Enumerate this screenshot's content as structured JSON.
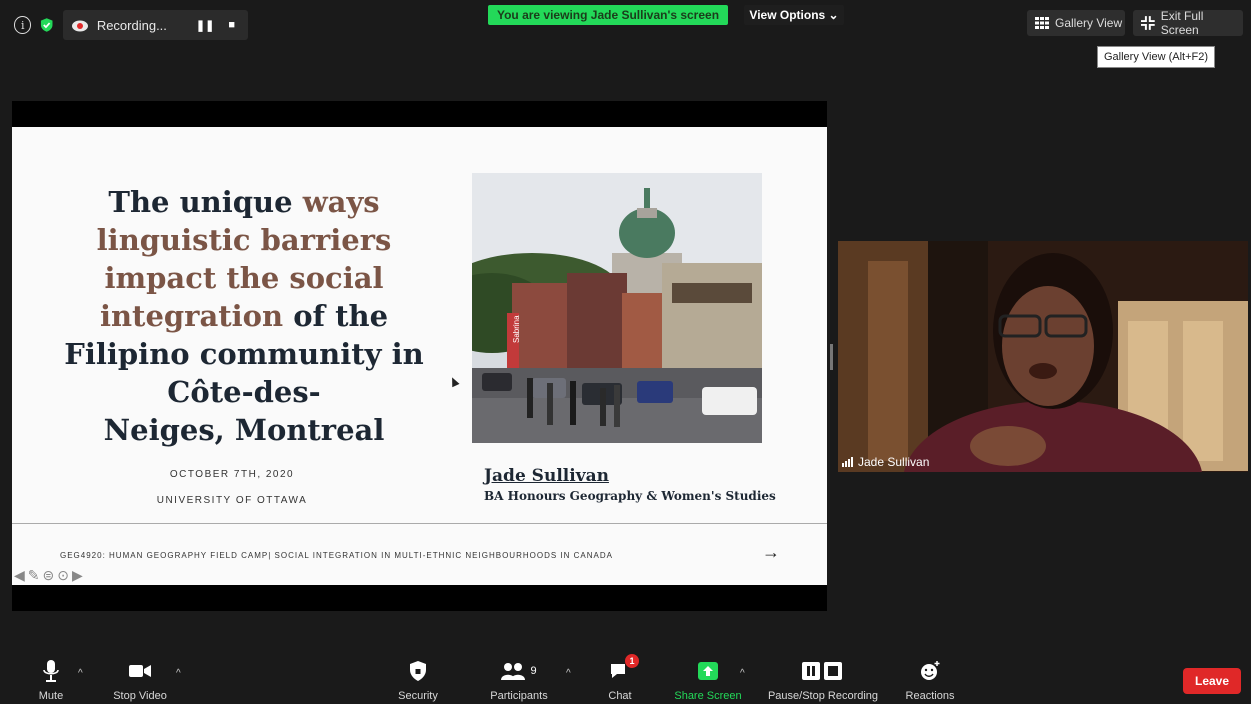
{
  "recording": {
    "label": "Recording...",
    "pause_glyph": "❚❚",
    "stop_glyph": "■"
  },
  "banner": {
    "viewing_text": "You are viewing Jade Sullivan's screen",
    "view_options": "View Options ⌄"
  },
  "top_right": {
    "gallery_view": "Gallery View",
    "exit_full_screen": "Exit Full Screen",
    "tooltip": "Gallery View (Alt+F2)"
  },
  "slide": {
    "title_parts": [
      "The uni",
      "que",
      " ways",
      "linguistic barriers",
      "impact the social",
      "integration",
      " of the",
      "Filipino community in",
      "Côte-des-",
      "Neiges, Montreal"
    ],
    "date": "OCTOBER 7TH, 2020",
    "university": "UNIVERSITY OF OTTAWA",
    "author": "Jade Sullivan",
    "degree": "BA Honours Geography & Women's Studies",
    "course": "GEG4920: HUMAN GEOGRAPHY FIELD CAMP| SOCIAL INTEGRATION IN MULTI-ETHNIC NEIGHBOURHOODS IN CANADA",
    "arrow": "→",
    "storefront_sign": "Sabrina"
  },
  "participant": {
    "name": "Jade Sullivan"
  },
  "toolbar": {
    "mute": "Mute",
    "stop_video": "Stop Video",
    "security": "Security",
    "participants": "Participants",
    "participants_count": "9",
    "chat": "Chat",
    "chat_badge": "1",
    "share_screen": "Share Screen",
    "pause_stop_recording": "Pause/Stop Recording",
    "reactions": "Reactions",
    "leave": "Leave"
  },
  "colors": {
    "share_green": "#23d959",
    "leave_red": "#e02828",
    "title_brown": "#7b5546",
    "title_navy": "#1d2733"
  }
}
